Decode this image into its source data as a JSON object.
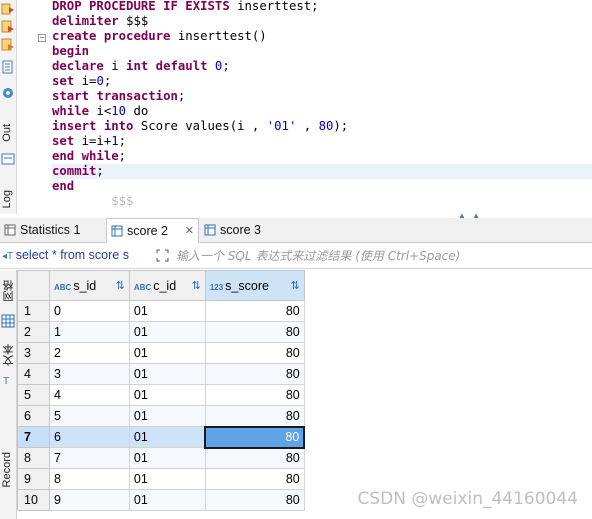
{
  "editor": {
    "lines": [
      {
        "type": "kw",
        "text": "DROP PROCEDURE IF EXISTS inserttest;"
      },
      {
        "type": "kw",
        "text": "delimiter $$$"
      },
      {
        "type": "kw",
        "text": "create procedure inserttest()"
      },
      {
        "type": "kw",
        "text": "begin"
      },
      {
        "type": "kw",
        "text": "declare i int default 0;"
      },
      {
        "type": "kw",
        "text": "set i=0;"
      },
      {
        "type": "kw",
        "text": "start transaction;"
      },
      {
        "type": "kw",
        "text": "while i<10 do"
      },
      {
        "type": "kw",
        "text": "insert into Score values(i , '01' , 80);"
      },
      {
        "type": "kw",
        "text": "set i=i+1;"
      },
      {
        "type": "kw",
        "text": "end while;"
      },
      {
        "type": "kw",
        "text": "commit;"
      },
      {
        "type": "kw",
        "text": "end"
      },
      {
        "type": "dim",
        "text": "        $$$"
      }
    ],
    "side_tabs": {
      "output": "Out",
      "log": "Log"
    }
  },
  "result_tabs": [
    {
      "label": "Statistics 1",
      "active": false
    },
    {
      "label": "score 2",
      "active": true
    },
    {
      "label": "score 3",
      "active": false
    }
  ],
  "filter": {
    "query": "select * from score s",
    "placeholder": "输入一个 SQL 表达式来过滤结果 (使用 Ctrl+Space)"
  },
  "grid_side_tabs": {
    "grid": "网格",
    "text": "文本",
    "record": "Record"
  },
  "columns": [
    {
      "name": "s_id",
      "type_icon": "ABC"
    },
    {
      "name": "c_id",
      "type_icon": "ABC"
    },
    {
      "name": "s_score",
      "type_icon": "123"
    }
  ],
  "rows": [
    {
      "rownum": "1",
      "s_id": "0",
      "c_id": "01",
      "s_score": "80"
    },
    {
      "rownum": "2",
      "s_id": "1",
      "c_id": "01",
      "s_score": "80"
    },
    {
      "rownum": "3",
      "s_id": "2",
      "c_id": "01",
      "s_score": "80"
    },
    {
      "rownum": "4",
      "s_id": "3",
      "c_id": "01",
      "s_score": "80"
    },
    {
      "rownum": "5",
      "s_id": "4",
      "c_id": "01",
      "s_score": "80"
    },
    {
      "rownum": "6",
      "s_id": "5",
      "c_id": "01",
      "s_score": "80"
    },
    {
      "rownum": "7",
      "s_id": "6",
      "c_id": "01",
      "s_score": "80"
    },
    {
      "rownum": "8",
      "s_id": "7",
      "c_id": "01",
      "s_score": "80"
    },
    {
      "rownum": "9",
      "s_id": "8",
      "c_id": "01",
      "s_score": "80"
    },
    {
      "rownum": "10",
      "s_id": "9",
      "c_id": "01",
      "s_score": "80"
    }
  ],
  "selected_row": 6,
  "watermark": "CSDN @weixin_44160044",
  "colors": {
    "accent": "#5fa4e6",
    "keyword": "#7f0055",
    "number": "#0000c0",
    "string": "#2a00ff"
  }
}
